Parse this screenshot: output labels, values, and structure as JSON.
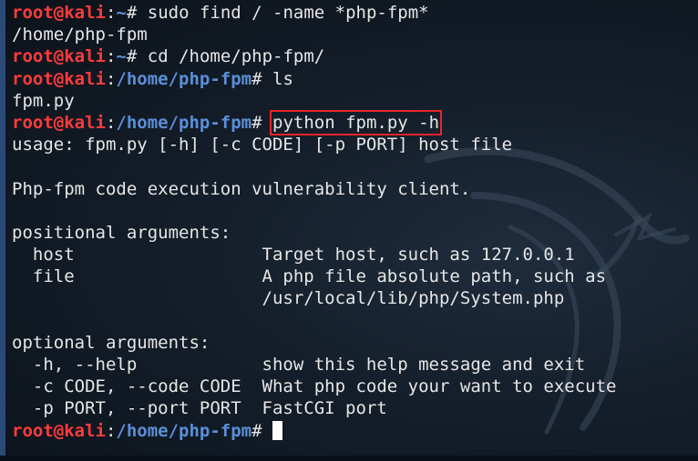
{
  "terminal": {
    "colors": {
      "background": "#141e2a",
      "user": "#ff3b3b",
      "path": "#5a8fd8",
      "text": "#e6e6e6",
      "highlight_box": "#e8242a",
      "cursor": "#ffffff"
    },
    "background_icon": "kali-dragon-icon",
    "lines": [
      {
        "type": "prompt",
        "user": "root@kali",
        "sep": ":",
        "path": "~",
        "sym": "# ",
        "cmd": "sudo find / -name *php-fpm*"
      },
      {
        "type": "out",
        "text": "/home/php-fpm"
      },
      {
        "type": "prompt",
        "user": "root@kali",
        "sep": ":",
        "path": "~",
        "sym": "# ",
        "cmd": "cd /home/php-fpm/"
      },
      {
        "type": "prompt",
        "user": "root@kali",
        "sep": ":",
        "path": "/home/php-fpm",
        "sym": "# ",
        "cmd": "ls"
      },
      {
        "type": "out",
        "text": "fpm.py"
      },
      {
        "type": "prompt",
        "user": "root@kali",
        "sep": ":",
        "path": "/home/php-fpm",
        "sym": "# ",
        "cmd": "python fpm.py -h",
        "highlighted": true
      },
      {
        "type": "out",
        "text": "usage: fpm.py [-h] [-c CODE] [-p PORT] host file"
      },
      {
        "type": "out",
        "text": ""
      },
      {
        "type": "out",
        "text": "Php-fpm code execution vulnerability client."
      },
      {
        "type": "out",
        "text": ""
      },
      {
        "type": "out",
        "text": "positional arguments:"
      },
      {
        "type": "out",
        "text": "  host                  Target host, such as 127.0.0.1"
      },
      {
        "type": "out",
        "text": "  file                  A php file absolute path, such as"
      },
      {
        "type": "out",
        "text": "                        /usr/local/lib/php/System.php"
      },
      {
        "type": "out",
        "text": ""
      },
      {
        "type": "out",
        "text": "optional arguments:"
      },
      {
        "type": "out",
        "text": "  -h, --help            show this help message and exit"
      },
      {
        "type": "out",
        "text": "  -c CODE, --code CODE  What php code your want to execute"
      },
      {
        "type": "out",
        "text": "  -p PORT, --port PORT  FastCGI port"
      },
      {
        "type": "prompt",
        "user": "root@kali",
        "sep": ":",
        "path": "/home/php-fpm",
        "sym": "# ",
        "cmd": "",
        "cursor": true
      }
    ]
  }
}
